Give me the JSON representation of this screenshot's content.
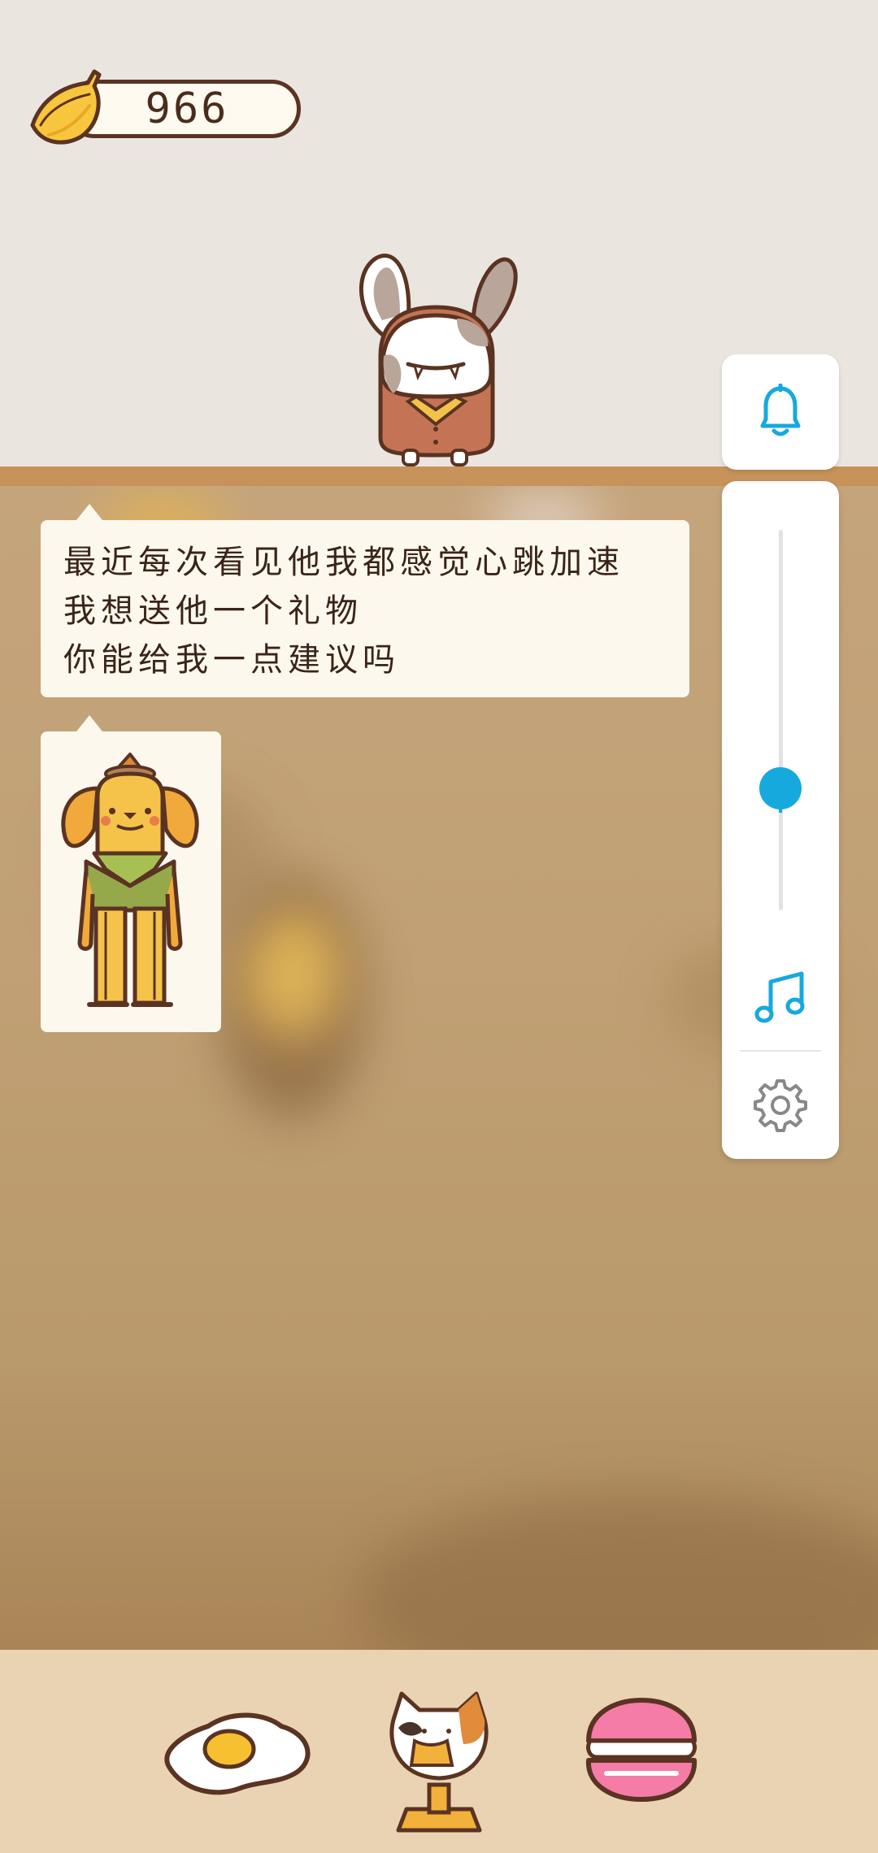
{
  "currency": {
    "icon": "banana-icon",
    "value": "966"
  },
  "dialogue": {
    "lines": [
      "最近每次看见他我都感觉心跳加速",
      "我想送他一个礼物",
      "你能给我一点建议吗"
    ]
  },
  "volume": {
    "level": 0.32
  },
  "side_buttons": [
    "bell-icon",
    "music-note-icon",
    "gear-icon"
  ],
  "bottom_items": [
    "fried-egg-icon",
    "cat-trophy-icon",
    "macaron-icon"
  ],
  "colors": {
    "accent": "#16a9de",
    "outline": "#5a3322",
    "bar": "#ead3b2"
  }
}
